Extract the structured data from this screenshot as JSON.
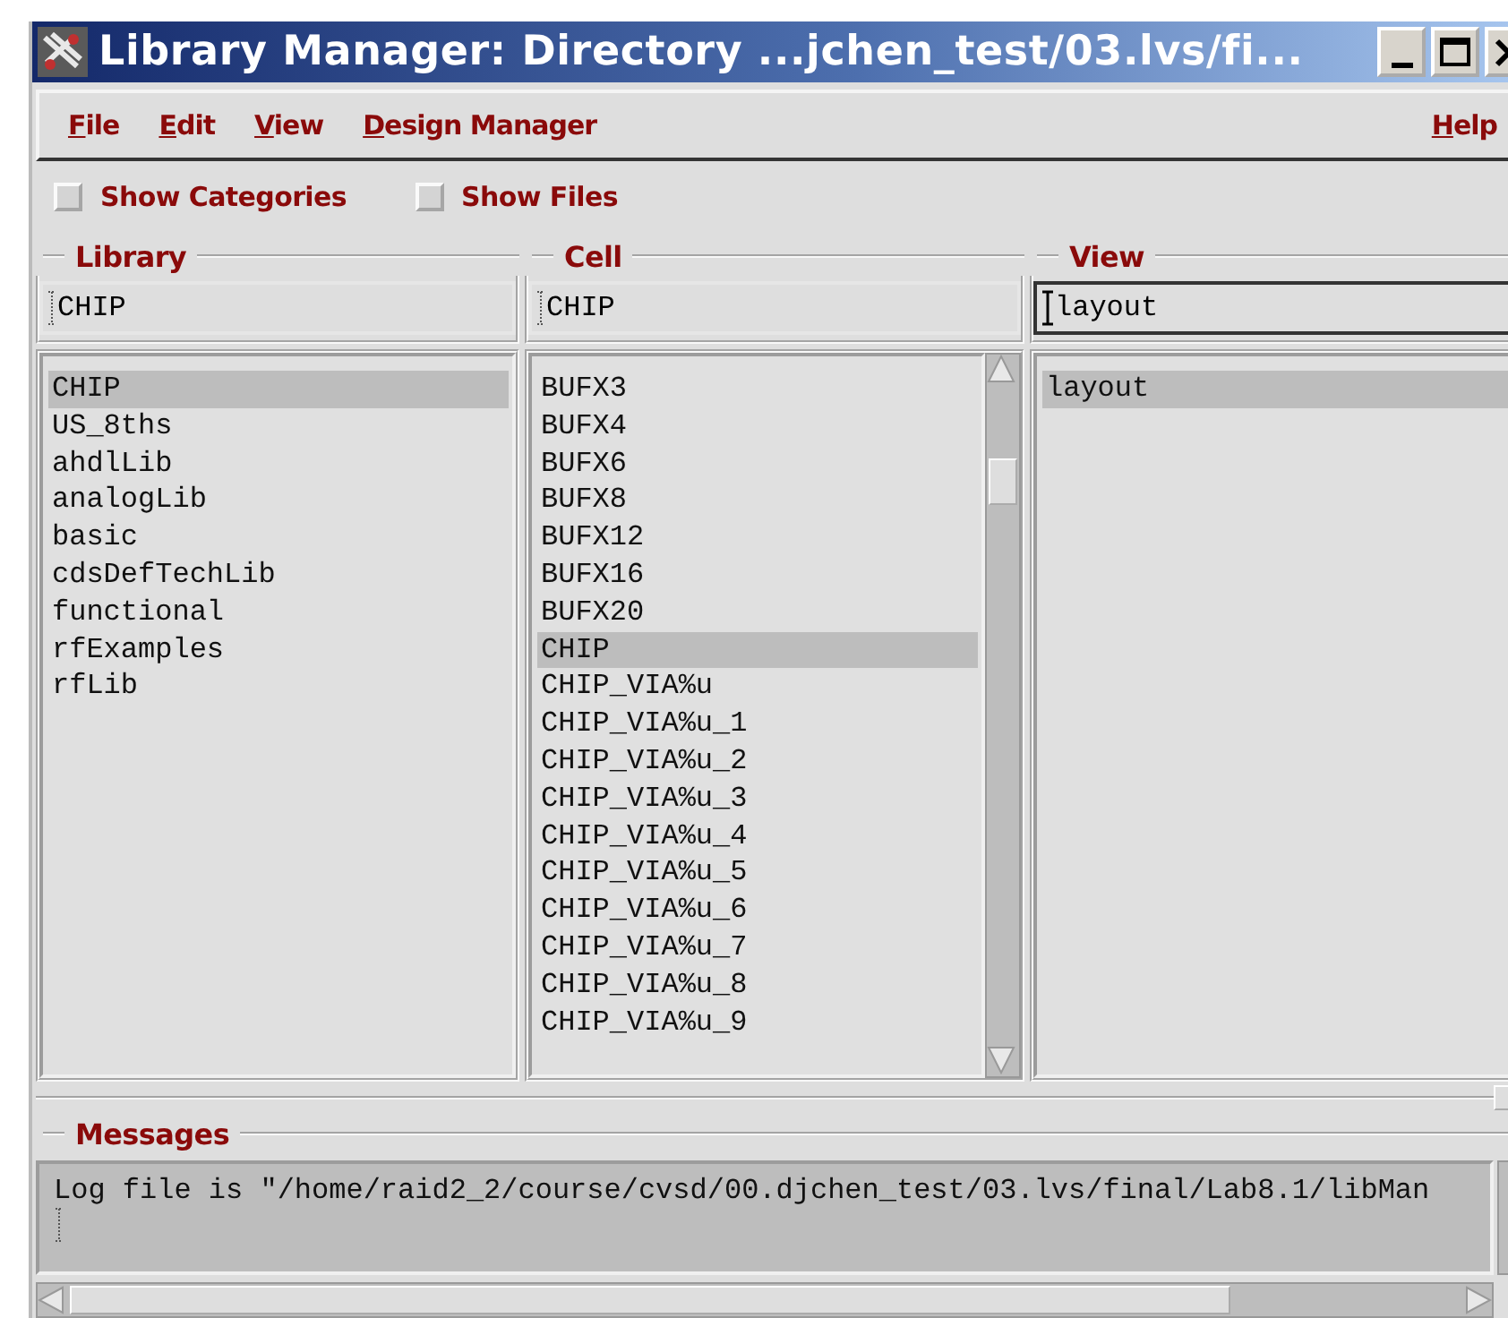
{
  "window": {
    "title": "Library Manager: Directory ...jchen_test/03.lvs/fi..."
  },
  "menu": [
    {
      "label": "File"
    },
    {
      "label": "Edit"
    },
    {
      "label": "View"
    },
    {
      "label": "Design Manager"
    }
  ],
  "help_menu": {
    "label": "Help"
  },
  "options": [
    {
      "label": "Show Categories",
      "checked": false
    },
    {
      "label": "Show Files",
      "checked": false
    }
  ],
  "columns": [
    {
      "title": "Library",
      "field": "CHIP",
      "focused": false,
      "has_scrollbar": false,
      "items": [
        {
          "label": "CHIP",
          "selected": true
        },
        {
          "label": "US_8ths",
          "selected": false
        },
        {
          "label": "ahdlLib",
          "selected": false
        },
        {
          "label": "analogLib",
          "selected": false
        },
        {
          "label": "basic",
          "selected": false
        },
        {
          "label": "cdsDefTechLib",
          "selected": false
        },
        {
          "label": "functional",
          "selected": false
        },
        {
          "label": "rfExamples",
          "selected": false
        },
        {
          "label": "rfLib",
          "selected": false
        }
      ]
    },
    {
      "title": "Cell",
      "field": "CHIP",
      "focused": false,
      "has_scrollbar": true,
      "items": [
        {
          "label": "BUFX3",
          "selected": false
        },
        {
          "label": "BUFX4",
          "selected": false
        },
        {
          "label": "BUFX6",
          "selected": false
        },
        {
          "label": "BUFX8",
          "selected": false
        },
        {
          "label": "BUFX12",
          "selected": false
        },
        {
          "label": "BUFX16",
          "selected": false
        },
        {
          "label": "BUFX20",
          "selected": false
        },
        {
          "label": "CHIP",
          "selected": true
        },
        {
          "label": "CHIP_VIA%u",
          "selected": false
        },
        {
          "label": "CHIP_VIA%u_1",
          "selected": false
        },
        {
          "label": "CHIP_VIA%u_2",
          "selected": false
        },
        {
          "label": "CHIP_VIA%u_3",
          "selected": false
        },
        {
          "label": "CHIP_VIA%u_4",
          "selected": false
        },
        {
          "label": "CHIP_VIA%u_5",
          "selected": false
        },
        {
          "label": "CHIP_VIA%u_6",
          "selected": false
        },
        {
          "label": "CHIP_VIA%u_7",
          "selected": false
        },
        {
          "label": "CHIP_VIA%u_8",
          "selected": false
        },
        {
          "label": "CHIP_VIA%u_9",
          "selected": false
        }
      ]
    },
    {
      "title": "View",
      "field": "layout",
      "focused": true,
      "has_scrollbar": false,
      "items": [
        {
          "label": "layout",
          "selected": true
        }
      ]
    }
  ],
  "messages": {
    "title": "Messages",
    "lines": [
      "Log file is \"/home/raid2_2/course/cvsd/00.djchen_test/03.lvs/final/Lab8.1/libMan"
    ]
  }
}
